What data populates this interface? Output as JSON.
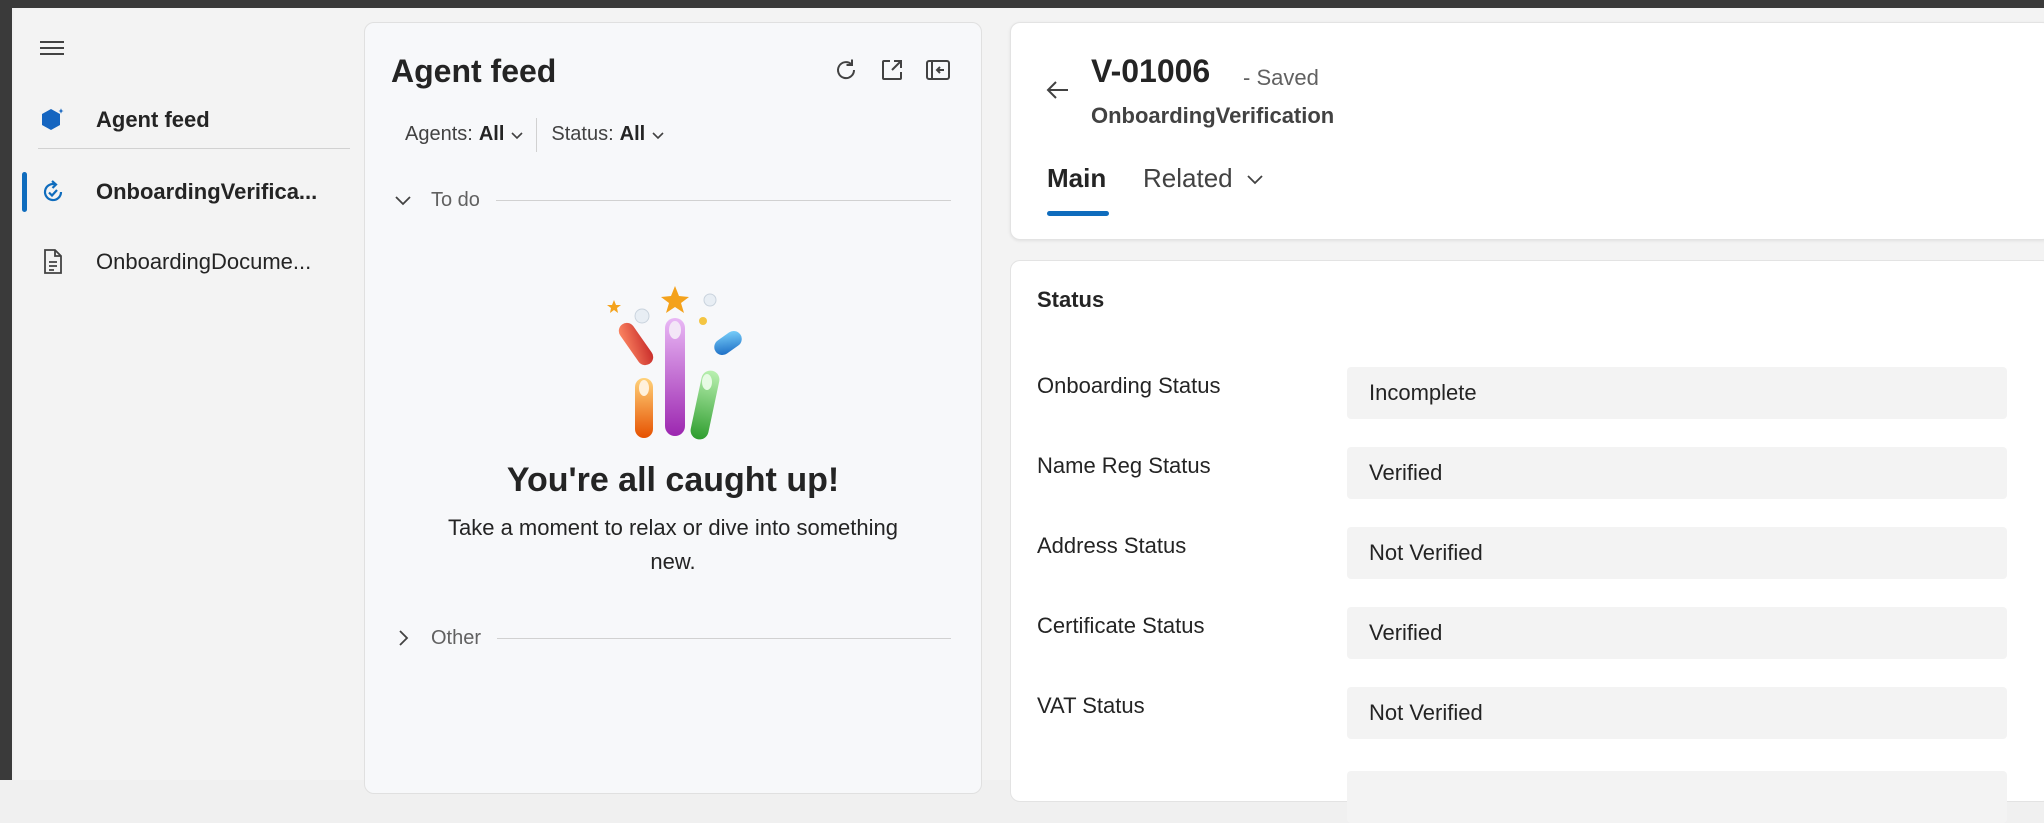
{
  "nav": {
    "items": [
      {
        "label": "Agent feed",
        "icon": "agent-sparkle-icon"
      },
      {
        "label": "OnboardingVerifica...",
        "icon": "task-refresh-icon"
      },
      {
        "label": "OnboardingDocume...",
        "icon": "document-icon"
      }
    ],
    "accent": "#0f6cbd"
  },
  "feed": {
    "title": "Agent feed",
    "filters": [
      {
        "label": "Agents:",
        "value": "All"
      },
      {
        "label": "Status:",
        "value": "All"
      }
    ],
    "sections": [
      {
        "label": "To do",
        "expanded": true
      },
      {
        "label": "Other",
        "expanded": false
      }
    ],
    "empty_title": "You're all caught up!",
    "empty_subtitle": "Take a moment to relax or dive into something new."
  },
  "record": {
    "title": "V-01006",
    "saved": "- Saved",
    "entity": "OnboardingVerification",
    "tabs": [
      {
        "label": "Main",
        "selected": true
      },
      {
        "label": "Related",
        "selected": false
      }
    ]
  },
  "status_section": {
    "title": "Status",
    "fields": [
      {
        "label": "Onboarding Status",
        "value": "Incomplete"
      },
      {
        "label": "Name Reg Status",
        "value": "Verified"
      },
      {
        "label": "Address Status",
        "value": "Not Verified"
      },
      {
        "label": "Certificate Status",
        "value": "Verified"
      },
      {
        "label": "VAT Status",
        "value": "Not Verified"
      }
    ]
  }
}
